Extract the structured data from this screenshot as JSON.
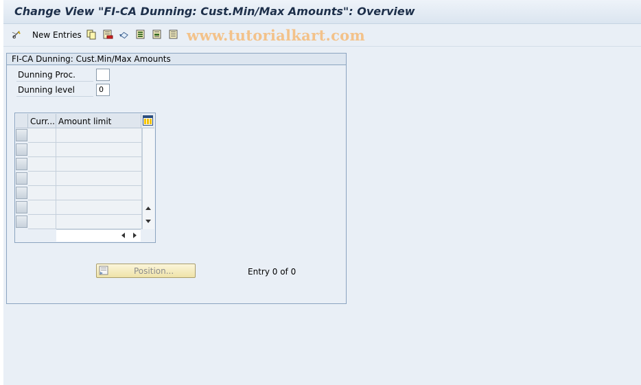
{
  "window": {
    "title": "Change View \"FI-CA Dunning: Cust.Min/Max Amounts\": Overview"
  },
  "toolbar": {
    "new_entries_label": "New Entries",
    "icons": [
      "edit-glasses-icon",
      "copy-icon",
      "delete-icon",
      "undo-icon",
      "select-all-icon",
      "select-block-icon",
      "deselect-all-icon"
    ],
    "watermark": "www.tutorialkart.com"
  },
  "group": {
    "title": "FI-CA Dunning: Cust.Min/Max Amounts",
    "fields": [
      {
        "label": "Dunning Proc.",
        "value": ""
      },
      {
        "label": "Dunning level",
        "value": "0"
      }
    ]
  },
  "table": {
    "columns": [
      "Curr...",
      "Amount limit"
    ],
    "visible_rows": 7,
    "rows": []
  },
  "footer": {
    "position_button": "Position...",
    "entry_count": "Entry 0 of 0"
  },
  "colors": {
    "background": "#e9eff6",
    "title_text": "#1d2f4a",
    "watermark": "#f3c28a",
    "button_bg": "#f4ebbf"
  }
}
